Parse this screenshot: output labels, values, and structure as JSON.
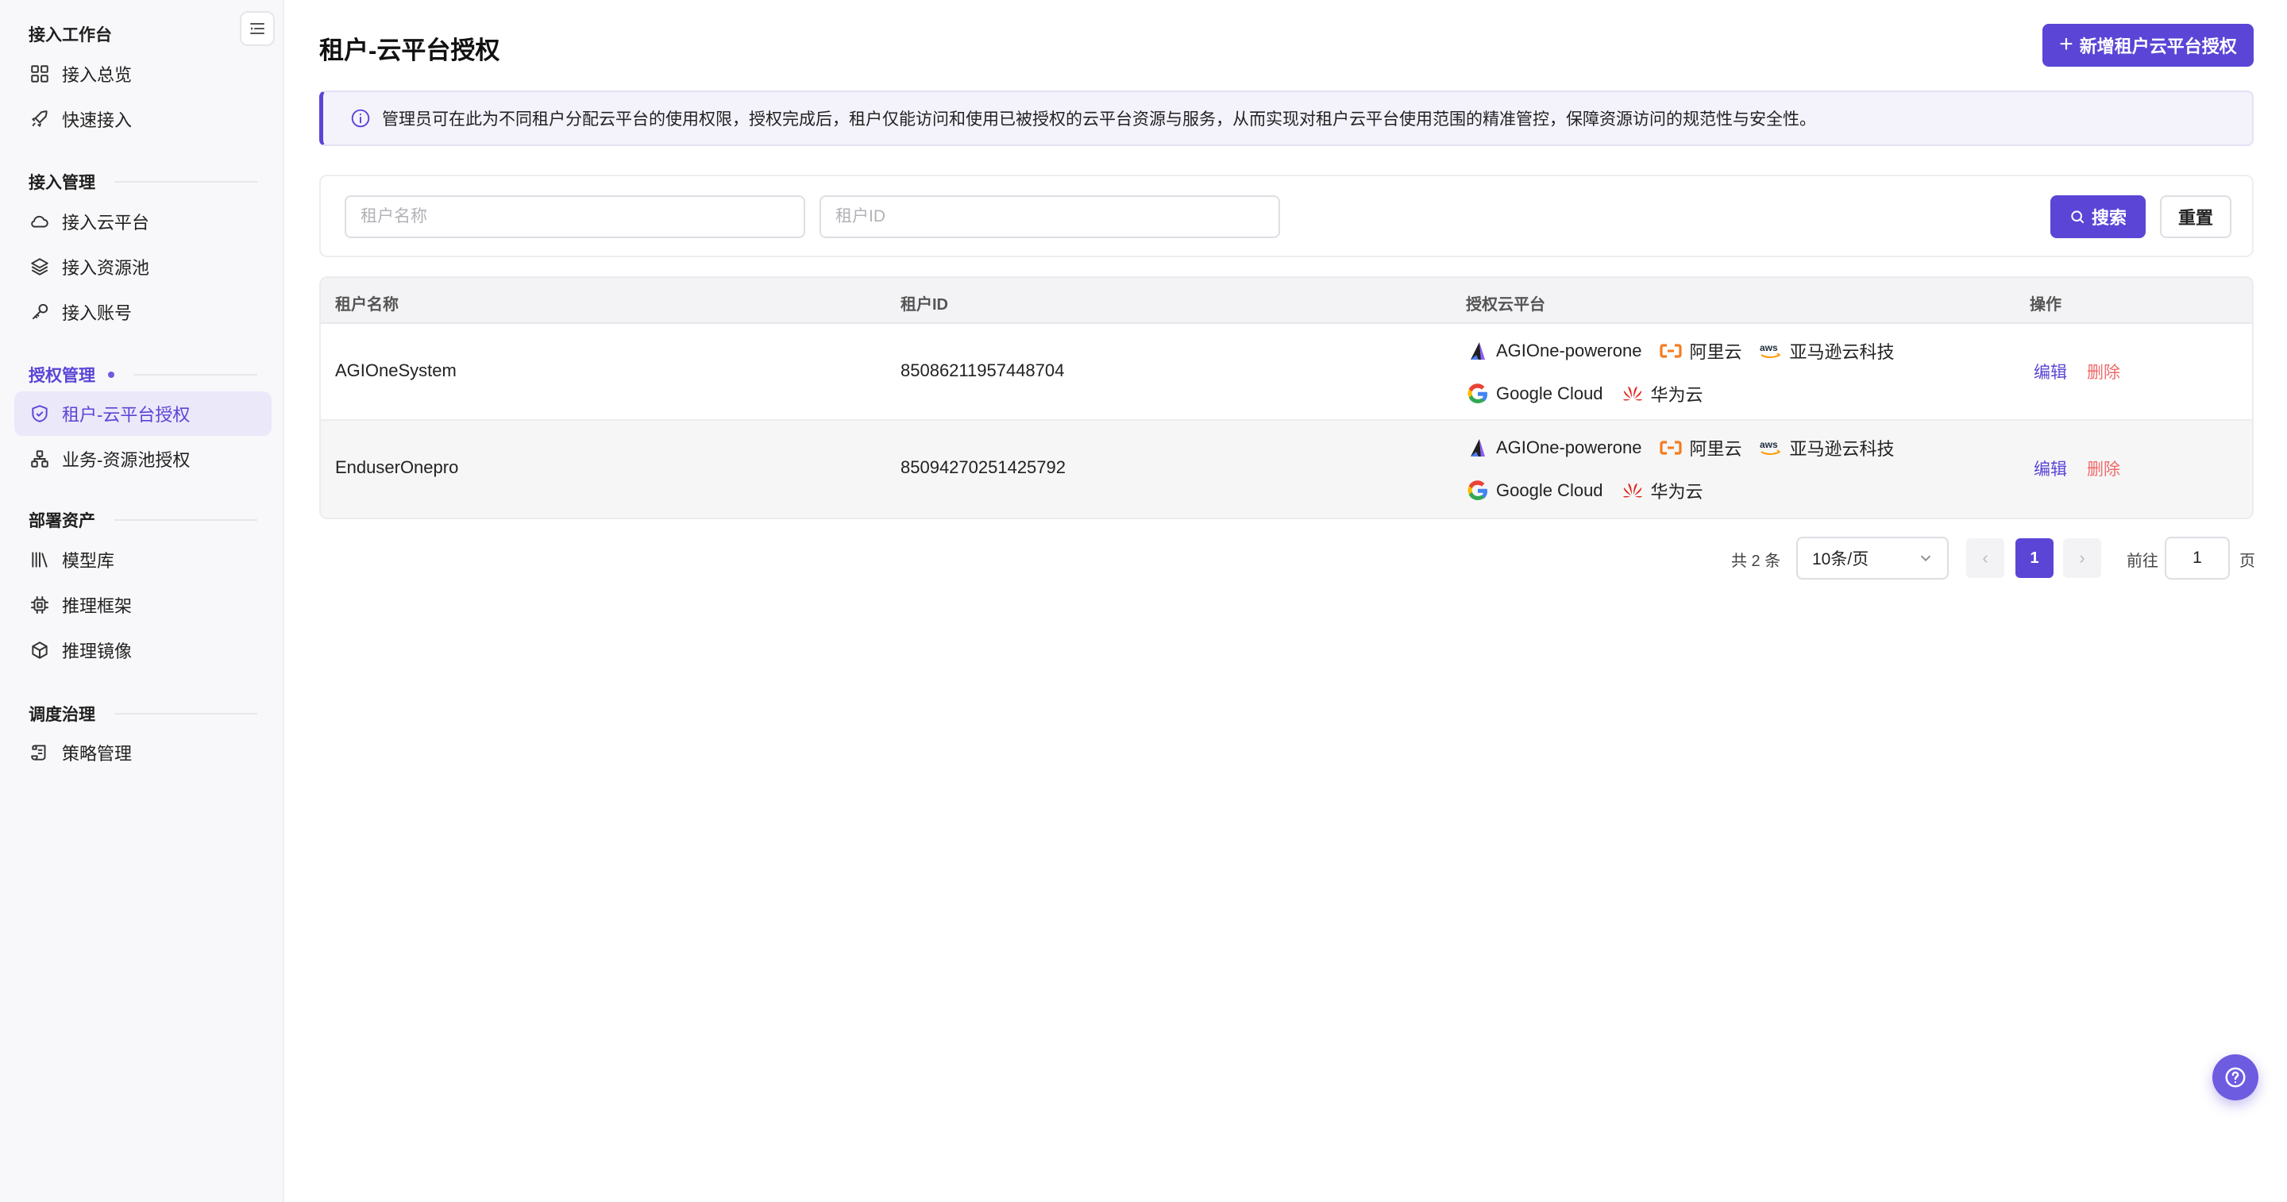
{
  "sidebar": {
    "groups": [
      {
        "title": "接入工作台",
        "items": [
          {
            "label": "接入总览",
            "icon": "grid-icon"
          },
          {
            "label": "快速接入",
            "icon": "rocket-icon"
          }
        ]
      },
      {
        "title": "接入管理",
        "items": [
          {
            "label": "接入云平台",
            "icon": "cloud-icon"
          },
          {
            "label": "接入资源池",
            "icon": "layers-icon"
          },
          {
            "label": "接入账号",
            "icon": "key-icon"
          }
        ]
      },
      {
        "title": "授权管理",
        "items": [
          {
            "label": "租户-云平台授权",
            "icon": "shield-icon"
          },
          {
            "label": "业务-资源池授权",
            "icon": "network-icon"
          }
        ]
      },
      {
        "title": "部署资产",
        "items": [
          {
            "label": "模型库",
            "icon": "library-icon"
          },
          {
            "label": "推理框架",
            "icon": "chip-icon"
          },
          {
            "label": "推理镜像",
            "icon": "box-icon"
          }
        ]
      },
      {
        "title": "调度治理",
        "items": [
          {
            "label": "策略管理",
            "icon": "scroll-icon"
          }
        ]
      }
    ],
    "active_item": "租户-云平台授权",
    "accent_color": "#5a45d6"
  },
  "page": {
    "title": "租户-云平台授权",
    "add_button": "新增租户云平台授权",
    "notice": "管理员可在此为不同租户分配云平台的使用权限，授权完成后，租户仅能访问和使用已被授权的云平台资源与服务，从而实现对租户云平台使用范围的精准管控，保障资源访问的规范性与安全性。"
  },
  "filters": {
    "tenant_name_placeholder": "租户名称",
    "tenant_id_placeholder": "租户ID",
    "search_label": "搜索",
    "reset_label": "重置"
  },
  "table": {
    "headers": {
      "name": "租户名称",
      "id": "租户ID",
      "platforms": "授权云平台",
      "ops": "操作"
    },
    "rows": [
      {
        "name": "AGIOneSystem",
        "id": "85086211957448704",
        "platforms": [
          "AGIOne-powerone",
          "阿里云",
          "亚马逊云科技",
          "Google Cloud",
          "华为云"
        ],
        "edit": "编辑",
        "delete": "删除"
      },
      {
        "name": "EnduserOnepro",
        "id": "85094270251425792",
        "platforms": [
          "AGIOne-powerone",
          "阿里云",
          "亚马逊云科技",
          "Google Cloud",
          "华为云"
        ],
        "edit": "编辑",
        "delete": "删除"
      }
    ]
  },
  "pagination": {
    "total": "共 2 条",
    "page_size": "10条/页",
    "prev": "‹",
    "current": "1",
    "next": "›",
    "goto_label": "前往",
    "goto_value": "1",
    "page_suffix": "页"
  }
}
